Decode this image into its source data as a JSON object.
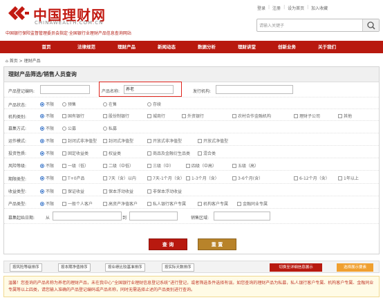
{
  "header": {
    "logo_cn": "中国理财网",
    "logo_en": "CHINAWEALTH.COM.CN",
    "logo_sub": "中国银行保险监督管理委员会指定·全国银行业理财产品信息查询网站",
    "top_links": [
      "登录",
      "注册",
      "设为首页",
      "加入收藏"
    ],
    "search_placeholder": "请输入关键子"
  },
  "nav": [
    "首页",
    "法律规范",
    "理财产品",
    "新闻动态",
    "数据分析",
    "理财讲堂",
    "创新业务",
    "关于我们"
  ],
  "breadcrumb": [
    "首页",
    "理财产品"
  ],
  "panel": {
    "title": "理财产品筛选/销售人员查询",
    "register_label": "产品登记编码:",
    "name_label": "产品名称:",
    "name_value": "养老",
    "issuer_label": "发行机构:",
    "status": {
      "label": "产品状态:",
      "options": [
        "不限",
        "预售",
        "在售",
        "存续"
      ]
    },
    "org_type": {
      "label": "机构类别:",
      "options": [
        "不限",
        "国有银行",
        "股份制银行",
        "城商行",
        "外资银行",
        "农村合作金融机构",
        "理财子公司",
        "其他"
      ]
    },
    "raise": {
      "label": "募集方式:",
      "options": [
        "不限",
        "公募",
        "私募"
      ]
    },
    "operation": {
      "label": "运作模式:",
      "options": [
        "不限",
        "封闭式非净值型",
        "封闭式净值型",
        "开放式非净值型",
        "开放式净值型"
      ]
    },
    "investment": {
      "label": "投资性质:",
      "options": [
        "不限",
        "固定收益类",
        "权益类",
        "商品及金融衍生品类",
        "混合类"
      ]
    },
    "risk": {
      "label": "风险等级:",
      "options": [
        "不限",
        "一级（低）",
        "二级（中低）",
        "三级（中）",
        "四级（中高）",
        "五级（高）"
      ]
    },
    "term": {
      "label": "期限类型:",
      "options": [
        "不限",
        "T+0产品",
        "7天（含）以内",
        "7天-1个月（含）",
        "1-3个月（含）",
        "3-6个月(含）",
        "6-12个月（含）",
        "1年以上"
      ]
    },
    "income": {
      "label": "收益类型:",
      "options": [
        "不限",
        "保证收益",
        "保本浮动收益",
        "非保本浮动收益"
      ]
    },
    "customer": {
      "label": "产品类型:",
      "options": [
        "不限",
        "一般个人客户",
        "高资产净值客户",
        "私人银行客户专属",
        "机构客户专属",
        "金融同业专属"
      ]
    },
    "raise_date": {
      "label": "募集起始日期:",
      "from": "从",
      "to": "到",
      "region_label": "销售区域:"
    },
    "query_btn": "查 询",
    "reset_btn": "重 置"
  },
  "sortbar": {
    "buttons": [
      "按风险等级排序",
      "按本期净值排序",
      "按业绩比较基准排序",
      "按实际天数排序"
    ],
    "switch": "切换至详细信息展示",
    "select": "选择展示要素"
  },
  "notice": "温馨！您查询的产品名称为养老的理财产品，未在我中心“全国银行业理财信息登记系统”进行登记，或者筛选条件选择有误。如您查询的理财产品为私募，私人银行客户专属、机构客户专属、金融同业专属等以上四类，请您输入准确的产品登记编码或产品名称，同时无需选择止述的产品类别进行查询。"
}
